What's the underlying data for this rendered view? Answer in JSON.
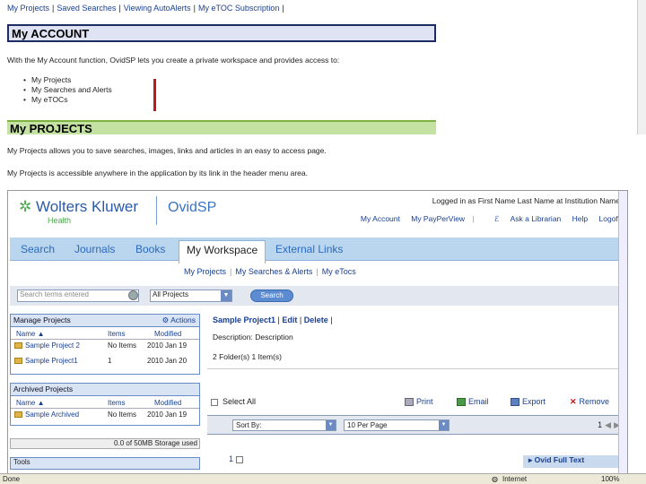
{
  "help": {
    "toplinks": [
      "My Projects",
      "Saved Searches",
      "Viewing AutoAlerts",
      "My eTOC Subscription"
    ],
    "account_title": "My ACCOUNT",
    "intro": "With the My Account function, OvidSP lets you create a private workspace and provides access to:",
    "bullets": [
      "My Projects",
      "My Searches and Alerts",
      "My eTOCs"
    ],
    "projects_title": "My PROJECTS",
    "para1": "My Projects allows you to save searches, images, links and articles in an easy to access page.",
    "para2": "My Projects is accessible anywhere in the application by its link in the header menu area."
  },
  "ovid": {
    "brand": "Wolters Kluwer",
    "brand_sub": "Health",
    "product": "OvidSP",
    "user_line": "Logged in as First Name Last Name at Institution Name",
    "util_links": [
      "My Account",
      "My PayPerView",
      "Ask a Librarian",
      "Help",
      "Logoff"
    ],
    "tabs": [
      "Search",
      "Journals",
      "Books",
      "My Workspace",
      "External Links"
    ],
    "active_tab": "My Workspace",
    "subnav": [
      "My Projects",
      "My Searches & Alerts",
      "My eTocs"
    ],
    "search_placeholder": "Search terms entered",
    "project_select": "All Projects",
    "search_button": "Search",
    "manage": {
      "title": "Manage Projects",
      "actions": "Actions",
      "cols": [
        "Name ▲",
        "Items",
        "Modified"
      ],
      "rows": [
        {
          "name": "Sample Project 2",
          "items": "No Items",
          "modified": "2010 Jan 19"
        },
        {
          "name": "Sample Project1",
          "items": "1",
          "modified": "2010 Jan 20"
        }
      ]
    },
    "archived": {
      "title": "Archived Projects",
      "cols": [
        "Name ▲",
        "Items",
        "Modified"
      ],
      "rows": [
        {
          "name": "Sample Archived",
          "items": "No Items",
          "modified": "2010 Jan 19"
        }
      ]
    },
    "storage": "0.0 of 50MB Storage used",
    "tools_title": "Tools",
    "project_title": "Sample Project1",
    "edit": "Edit",
    "delete": "Delete",
    "description": "Description: Description",
    "counts": "2 Folder(s) 1 Item(s)",
    "select_all": "Select All",
    "actions": [
      "Print",
      "Email",
      "Export",
      "Remove"
    ],
    "sort_by": "Sort By:",
    "per_page": "10 Per Page",
    "page": "1",
    "row_num": "1",
    "fulltext": "Ovid Full Text"
  },
  "status": {
    "left": "Done",
    "zone": "Internet",
    "zoom": "100%"
  },
  "colors": {
    "link": "#1a3f8f",
    "nav": "#b9d6ee",
    "account_bar": "#dfe3f3",
    "projects_bar": "#c4e3a3",
    "marker": "#c4161c"
  }
}
